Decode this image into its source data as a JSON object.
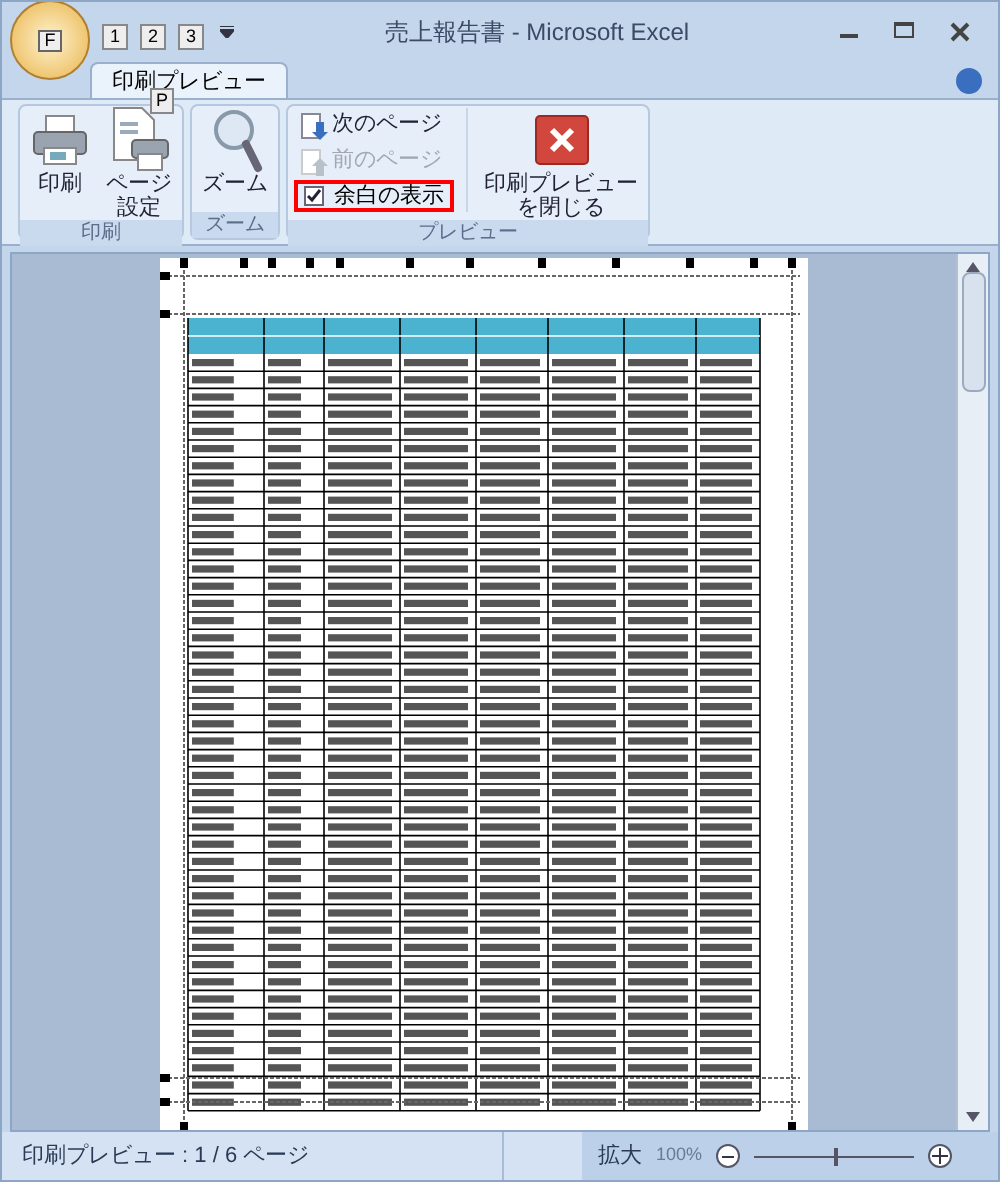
{
  "window": {
    "title": "売上報告書 - Microsoft Excel",
    "office_keytip": "F",
    "quick_access_keytips": [
      "1",
      "2",
      "3"
    ]
  },
  "tabs": [
    {
      "label": "印刷プレビュー",
      "selected": true,
      "keytip": "P"
    }
  ],
  "ribbon_groups": [
    {
      "label": "印刷",
      "buttons": [
        {
          "kind": "print",
          "lines": [
            "印刷"
          ]
        },
        {
          "kind": "page_setup",
          "lines": [
            "ページ",
            "設定"
          ]
        }
      ]
    },
    {
      "label": "ズーム",
      "buttons": [
        {
          "kind": "zoom",
          "lines": [
            "ズーム"
          ]
        }
      ]
    },
    {
      "label": "プレビュー",
      "small_items": [
        {
          "kind": "next",
          "label": "次のページ",
          "disabled": false
        },
        {
          "kind": "prev",
          "label": "前のページ",
          "disabled": true
        },
        {
          "kind": "checkbox",
          "label": "余白の表示",
          "checked": true,
          "highlighted": true
        }
      ],
      "buttons": [
        {
          "kind": "close",
          "lines": [
            "印刷プレビュー",
            "を閉じる"
          ]
        }
      ]
    }
  ],
  "status_bar": {
    "text": "印刷プレビュー : 1 / 6 ページ",
    "zoom_label": "拡大",
    "zoom_percent": "100%",
    "zoom_disabled": true,
    "zoom_slider": {
      "level": 0.5
    }
  }
}
